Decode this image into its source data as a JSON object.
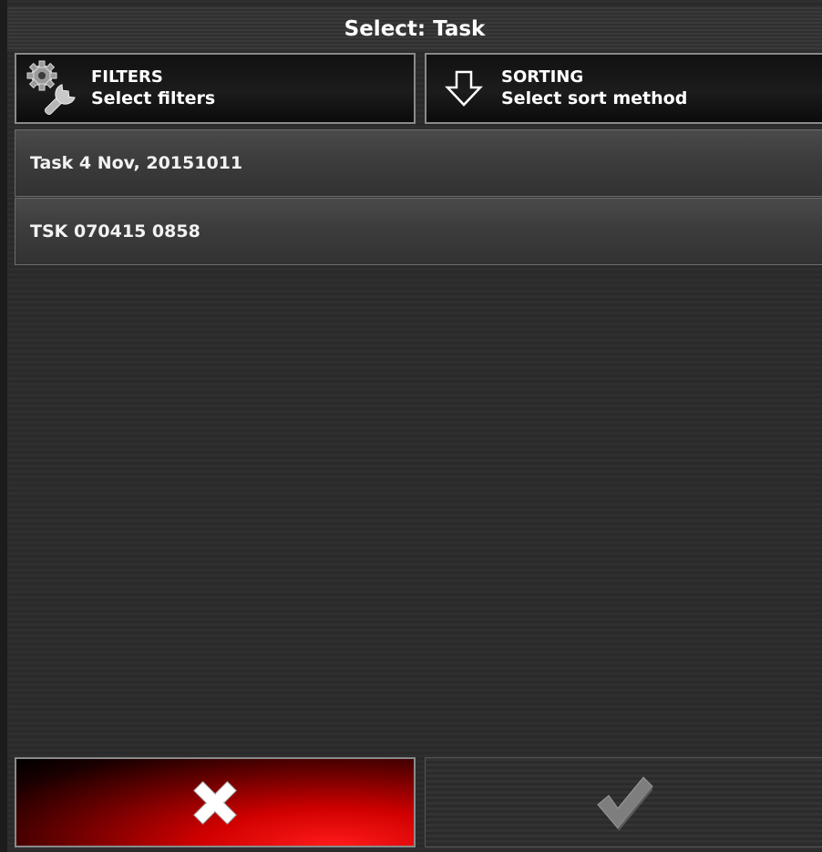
{
  "dialog": {
    "title": "Select: Task"
  },
  "filters": {
    "heading": "FILTERS",
    "subtitle": "Select filters",
    "icon": "wrench-gear-icon"
  },
  "sorting": {
    "heading": "SORTING",
    "subtitle": "Select sort method",
    "icon": "arrow-down-icon"
  },
  "tasks": [
    {
      "label": "Task 4 Nov, 20151011"
    },
    {
      "label": "TSK 070415 0858"
    }
  ],
  "actions": {
    "cancel_icon": "close-icon",
    "confirm_icon": "checkmark-icon",
    "cancel_color": "#d00000",
    "confirm_enabled": false
  }
}
